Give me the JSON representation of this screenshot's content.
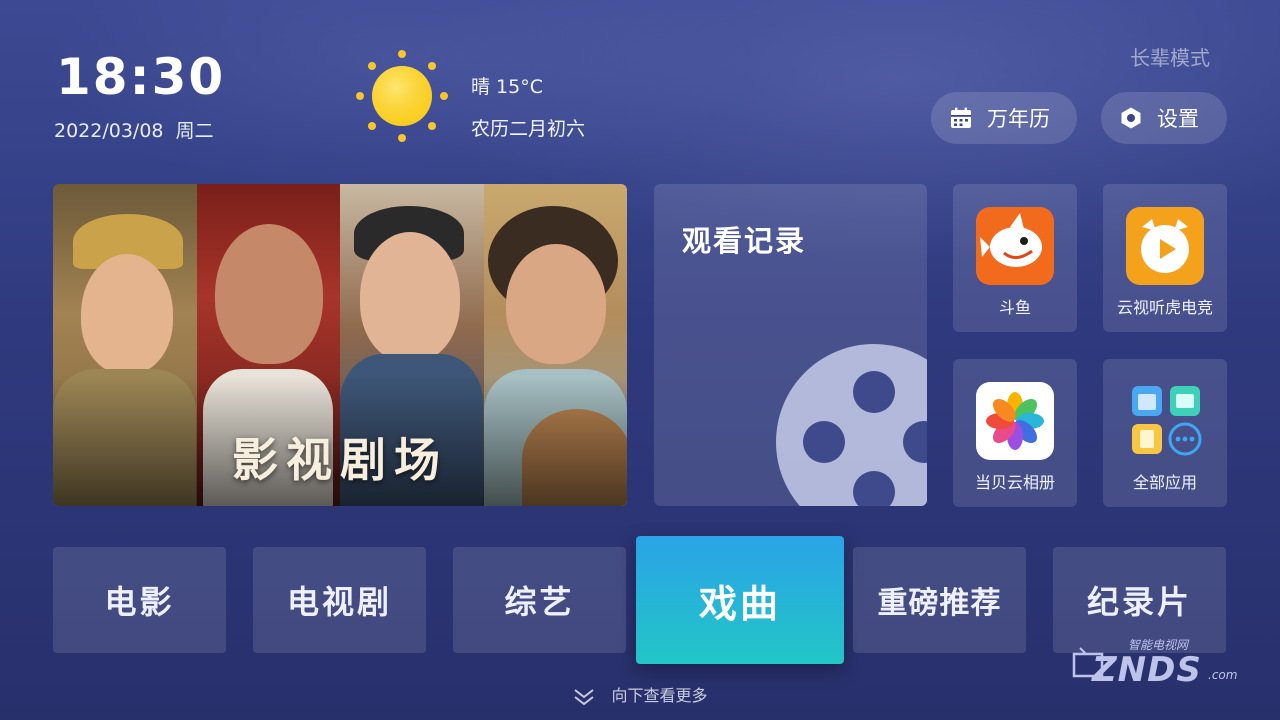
{
  "header": {
    "time": "18:30",
    "date": "2022/03/08  周二",
    "weather": "晴 15°C",
    "lunar": "农历二月初六",
    "mode_label": "长辈模式",
    "calendar_label": "万年历",
    "settings_label": "设置",
    "icons": {
      "weather": "sun-icon",
      "calendar": "calendar-icon",
      "settings": "gear-icon"
    }
  },
  "banner": {
    "title": "影视剧场"
  },
  "history": {
    "title": "观看记录",
    "icon": "film-reel-icon"
  },
  "apps": [
    {
      "label": "斗鱼",
      "icon": "douyu-shark-icon",
      "color": "#f26b1d"
    },
    {
      "label": "云视听虎电竞",
      "icon": "huya-tiger-icon",
      "color": "#f4a21c"
    },
    {
      "label": "当贝云相册",
      "icon": "photo-flower-icon",
      "color": "#ffffff"
    },
    {
      "label": "全部应用",
      "icon": "app-grid-icon",
      "color": "#3fa6f0"
    }
  ],
  "categories": [
    {
      "label": "电影"
    },
    {
      "label": "电视剧"
    },
    {
      "label": "综艺"
    },
    {
      "label": "戏曲",
      "focused": true
    },
    {
      "label": "重磅推荐"
    },
    {
      "label": "纪录片"
    }
  ],
  "footer": {
    "more_label": "向下查看更多",
    "icon": "chevron-double-down-icon"
  },
  "watermark": {
    "top": "智能电视网",
    "main": "ZNDS",
    "suffix": ".com"
  },
  "colors": {
    "focus_start": "#2aa3e8",
    "focus_end": "#22c6c6",
    "bg_top": "#3d4a93",
    "bg_bottom": "#28306c"
  }
}
